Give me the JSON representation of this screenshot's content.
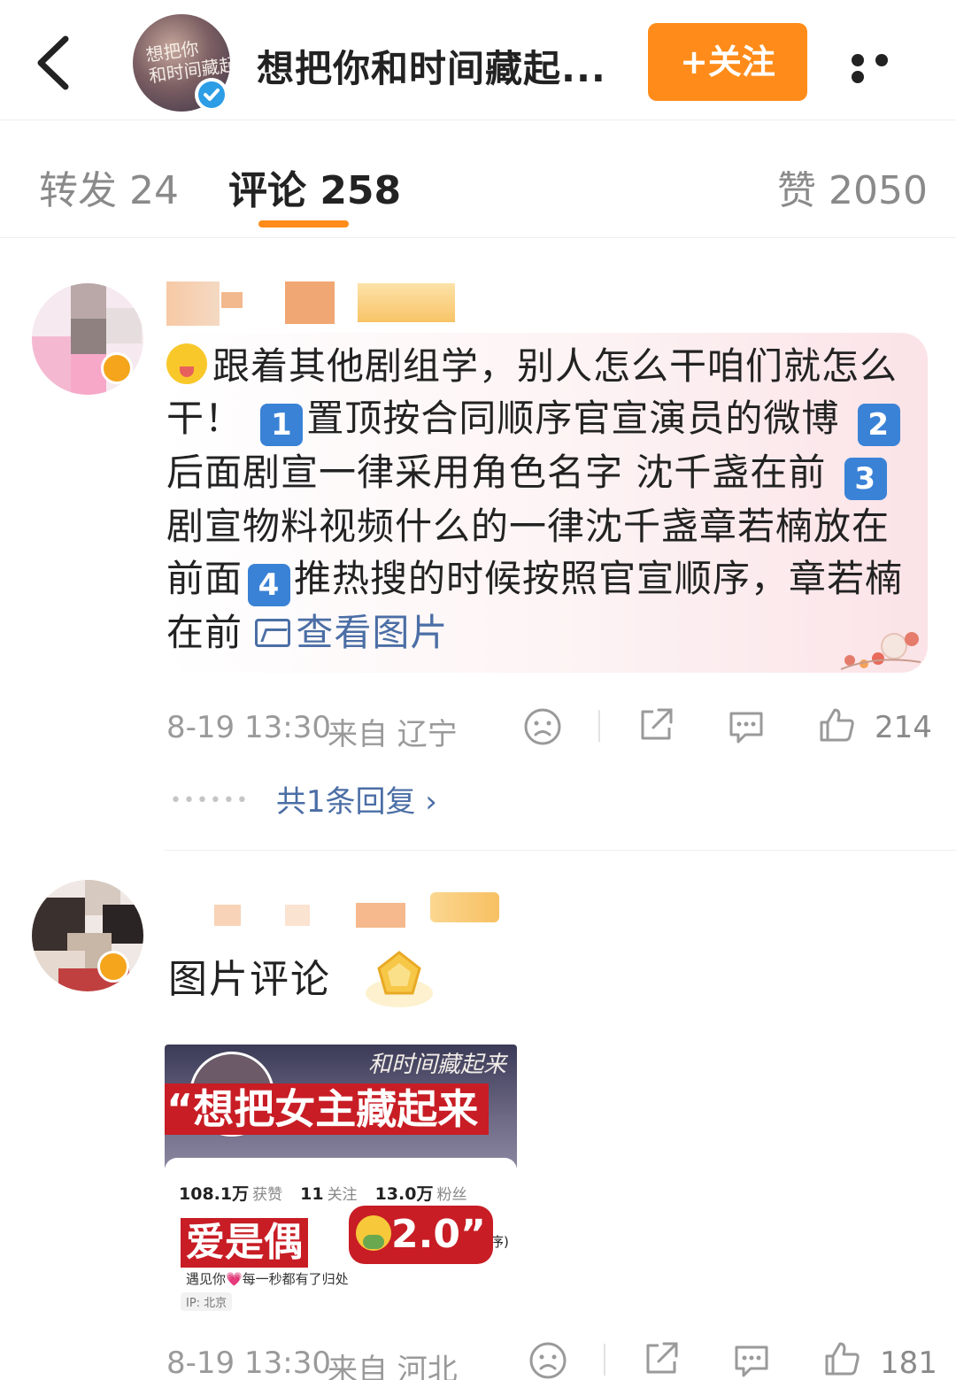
{
  "header": {
    "avatar_text": "想把你\n和时间藏起来",
    "title": "想把你和时间藏起...",
    "follow_label": "+关注"
  },
  "tabs": {
    "repost": "转发 24",
    "comments": "评论 258",
    "likes": "赞 2050"
  },
  "comments": [
    {
      "text_parts": {
        "p0": "跟着其他剧组学，别人怎么干咱们就怎么干！",
        "k1": "1",
        "p1": "置顶按合同顺序官宣演员的微博",
        "k2": "2",
        "p2": "后面剧宣一律采用角色名字 沈千盏在前",
        "k3": "3",
        "p3": "剧宣物料视频什么的一律沈千盏章若楠放在前面",
        "k4": "4",
        "p4": "推热搜的时候按照官宣顺序，章若楠在前",
        "view_image": "查看图片"
      },
      "timestamp": "8-19 13:30",
      "location": "来自 辽宁",
      "like_count": "214",
      "replies_label": "共1条回复 ›",
      "emoji_icon": "squinting-tongue-emoji",
      "keycap_color": "#3a82d6"
    },
    {
      "text": "图片评论",
      "timestamp": "8-19 13:30",
      "location": "来自 河北",
      "like_count": "181",
      "image": {
        "script_title": "和时间藏起来",
        "banner1": "“想把女主藏起来",
        "stats": [
          {
            "value": "108.1万",
            "label": "获赞"
          },
          {
            "value": "11",
            "label": "关注"
          },
          {
            "value": "13.0万",
            "label": "粉丝"
          }
        ],
        "banner2": "爱是偶",
        "banner3": "2.0”",
        "side_text": "画排序)",
        "bio": "遇见你💗每一秒都有了归处",
        "ip": "IP: 北京"
      }
    }
  ],
  "colors": {
    "accent": "#ff8c1a",
    "link": "#4b6ea5",
    "verified_blue": "#2d9de6",
    "verified_gold": "#f4a51c",
    "banner_red": "#c81d25"
  }
}
